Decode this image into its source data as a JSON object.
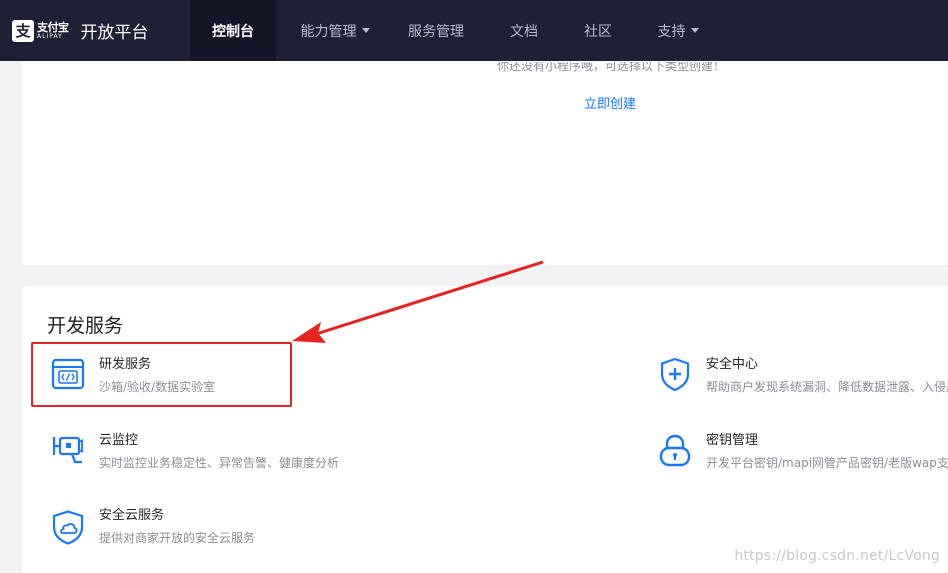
{
  "brand": {
    "logo_glyph": "支",
    "logo_cn": "支付宝",
    "logo_en": "ALIPAY",
    "title": "开放平台"
  },
  "nav": {
    "items": [
      {
        "label": "控制台"
      },
      {
        "label": "能力管理"
      },
      {
        "label": "服务管理"
      },
      {
        "label": "文档"
      },
      {
        "label": "社区"
      },
      {
        "label": "支持"
      }
    ]
  },
  "miniapp": {
    "empty_text": "你还没有小程序哦，可选择以下类型创建！",
    "create_link": "立即创建"
  },
  "dev_services": {
    "title": "开发服务",
    "items": [
      {
        "name": "研发服务",
        "desc": "沙箱/验收/数据实验室",
        "icon": "code-window-icon"
      },
      {
        "name": "安全中心",
        "desc": "帮助商户发现系统漏洞、降低数据泄露、入侵风险",
        "icon": "shield-plus-icon"
      },
      {
        "name": "云监控",
        "desc": "实时监控业务稳定性、异常告警、健康度分析",
        "icon": "monitor-camera-icon"
      },
      {
        "name": "密钥管理",
        "desc": "开发平台密钥/mapi网管产品密钥/老版wap支付密钥",
        "icon": "padlock-icon"
      },
      {
        "name": "安全云服务",
        "desc": "提供对商家开放的安全云服务",
        "icon": "shield-cloud-icon"
      }
    ]
  },
  "watermark": "https://blog.csdn.net/LcVong",
  "colors": {
    "nav_bg": "#1e2036",
    "accent": "#1677ff",
    "annotation_red": "#e8231d"
  }
}
